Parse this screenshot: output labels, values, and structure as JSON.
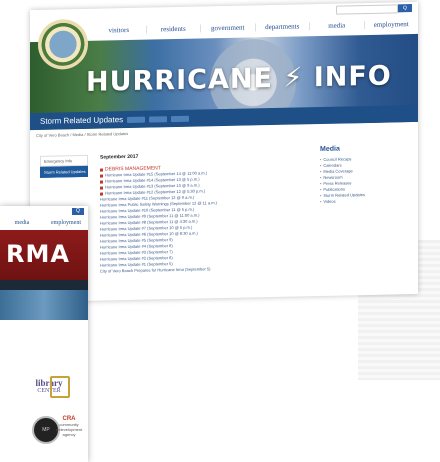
{
  "front": {
    "nav": [
      "visitors",
      "residents",
      "government",
      "departments",
      "media",
      "employment"
    ],
    "search_btn": "Q",
    "headline": "HURRICANE",
    "headline2": "INFO",
    "bar_title": "Storm Related Updates",
    "breadcrumb": "City of Vero Beach / Media / Storm Related Updates",
    "sidebar": [
      "Emergency Info",
      "Storm Related Updates"
    ],
    "list_head": "September 2017",
    "list": [
      "DEBRIS MANAGEMENT",
      "Hurricane Irma Update #15 (September 14 @ 11:00 a.m.)",
      "Hurricane Irma Update #14 (September 13 @ 5 p.m.)",
      "Hurricane Irma Update #13 (September 13 @ 9 a.m.)",
      "Hurricane Irma Update #12 (September 12 @ 5:30 p.m.)",
      "Hurricane Irma Update #11 (September 12 @ 9 a.m.)",
      "Hurricane Irma Public Safety Warnings (September 12 @ 11 a.m.)",
      "Hurricane Irma Update #10 (September 11 @ 5 p.m.)",
      "Hurricane Irma Update #9 (September 11 @ 11:00 a.m.)",
      "Hurricane Irma Update #8 (September 11 @ 4:30 a.m.)",
      "Hurricane Irma Update #7 (September 10 @ 5 p.m.)",
      "Hurricane Irma Update #6 (September 10 @ 8:30 a.m.)",
      "Hurricane Irma Update #5 (September 9)",
      "Hurricane Irma Update #4 (September 8)",
      "Hurricane Irma Update #3 (September 7)",
      "Hurricane Irma Update #2 (September 6)",
      "Hurricane Irma Update #1 (September 5)",
      "City of Vero Beach Prepares for Hurricane Irma (September 5)"
    ],
    "media_head": "Media",
    "media": [
      "Council Recaps",
      "Calendars",
      "Media Coverage",
      "Newsroom",
      "Press Releases",
      "Publications",
      "Storm Related Updates",
      "Videos"
    ]
  },
  "back": {
    "nav": [
      "media",
      "employment"
    ],
    "search_btn": "Q",
    "banner_word": "RMA",
    "library": "library",
    "library_sub": "CENTER",
    "stamp": "MP",
    "cra": "CRA",
    "cra_sub": "community redevelopment agency"
  }
}
